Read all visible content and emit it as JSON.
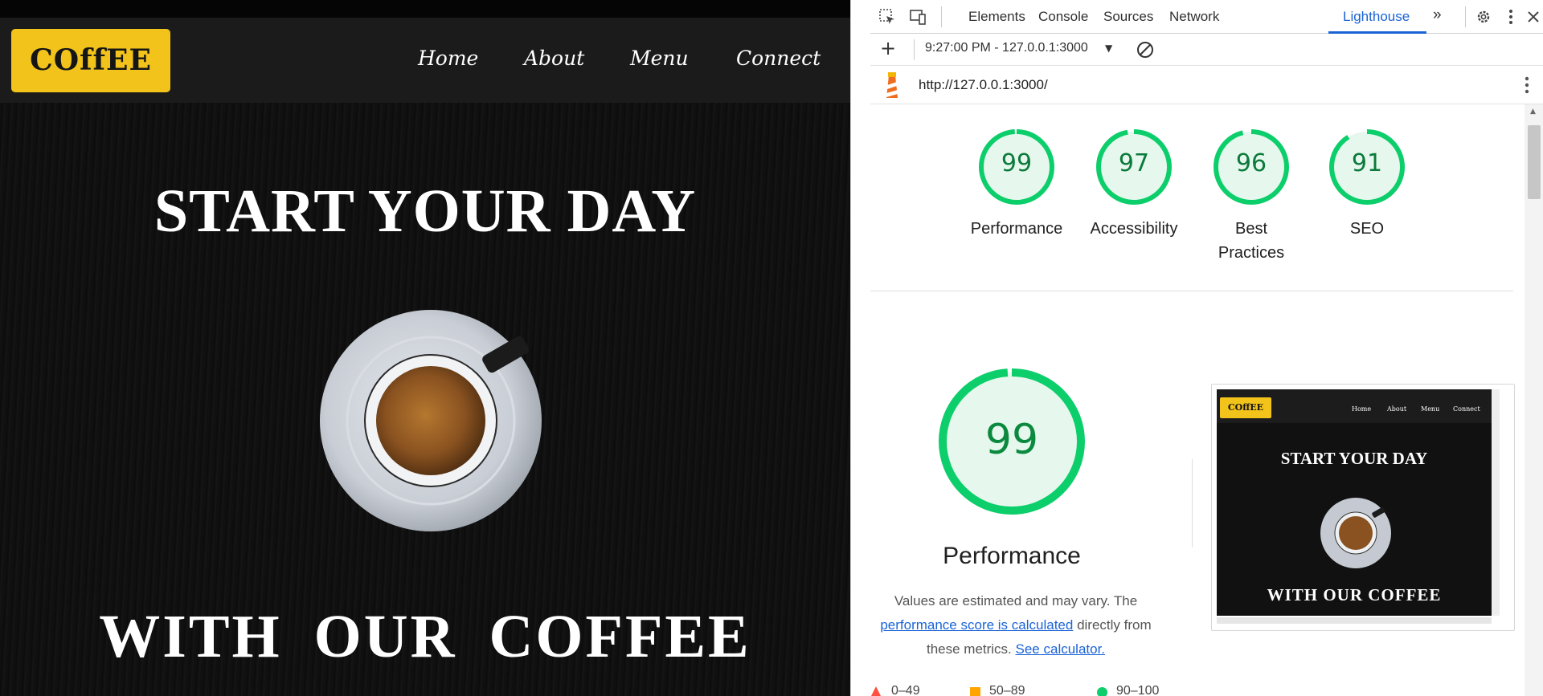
{
  "site": {
    "logo": "COffEE",
    "nav": [
      "Home",
      "About",
      "Menu",
      "Connect"
    ],
    "headline_top": "START YOUR DAY",
    "headline_bottom": "WITH OUR COFFEE"
  },
  "devtools": {
    "tabs": [
      "Elements",
      "Console",
      "Sources",
      "Network",
      "Lighthouse"
    ],
    "active_tab": "Lighthouse",
    "report_selector": "9:27:00 PM - 127.0.0.1:3000",
    "url": "http://127.0.0.1:3000/",
    "scores": [
      {
        "value": 99,
        "label": "Performance"
      },
      {
        "value": 97,
        "label": "Accessibility"
      },
      {
        "value": 96,
        "label": "Best Practices"
      },
      {
        "value": 91,
        "label": "SEO"
      }
    ],
    "performance": {
      "score": 99,
      "label": "Performance",
      "desc_text_1": "Values are estimated and may vary. The",
      "desc_link_1": "performance score is calculated",
      "desc_text_2": "directly from these metrics.",
      "desc_link_2": "See calculator."
    },
    "legend": [
      "0–49",
      "50–89",
      "90–100"
    ],
    "colors": {
      "good": "#0cce6b",
      "average": "#ffa400",
      "fail": "#ff4e42",
      "accent": "#1a63d6"
    }
  },
  "thumbnail": {
    "logo": "COffEE",
    "nav": [
      "Home",
      "About",
      "Menu",
      "Connect"
    ],
    "headline_top": "START YOUR DAY",
    "headline_bottom": "WITH OUR COFFEE"
  }
}
